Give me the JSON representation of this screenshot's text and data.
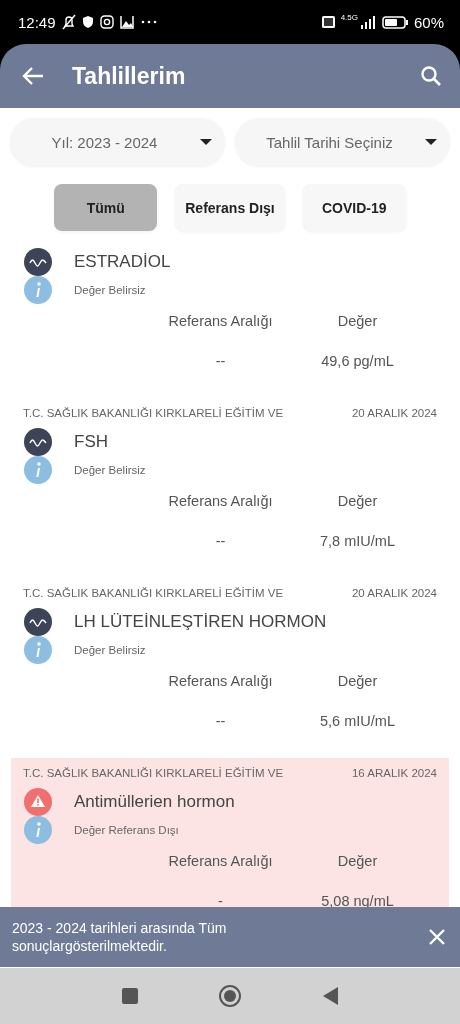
{
  "status_bar": {
    "time": "12:49",
    "network": "4.5G",
    "battery": "60%"
  },
  "app_bar": {
    "title": "Tahlillerim"
  },
  "filters": [
    {
      "label": "Yıl: 2023 - 2024"
    },
    {
      "label": "Tahlil Tarihi Seçiniz"
    }
  ],
  "chips": [
    {
      "label": "Tümü",
      "selected": true
    },
    {
      "label": "Referans Dışı",
      "selected": false
    },
    {
      "label": "COVID-19",
      "selected": false
    }
  ],
  "results": [
    {
      "test": "ESTRADİOL",
      "status": "Değer Belirsiz",
      "out_of_range": false,
      "range_label": "Referans Aralığı",
      "value_label": "Değer",
      "range": "--",
      "value": "49,6 pg/mL"
    },
    {
      "lab": "T.C. SAĞLIK BAKANLIĞI KIRKLARELİ EĞİTİM VE",
      "date": "20 ARALIK 2024",
      "test": "FSH",
      "status": "Değer Belirsiz",
      "out_of_range": false,
      "range_label": "Referans Aralığı",
      "value_label": "Değer",
      "range": "--",
      "value": "7,8 mIU/mL"
    },
    {
      "lab": "T.C. SAĞLIK BAKANLIĞI KIRKLARELİ EĞİTİM VE",
      "date": "20 ARALIK 2024",
      "test": "LH LÜTEİNLEŞTİREN HORMON",
      "status": "Değer Belirsiz",
      "out_of_range": false,
      "range_label": "Referans Aralığı",
      "value_label": "Değer",
      "range": "--",
      "value": "5,6 mIU/mL"
    },
    {
      "lab": "T.C. SAĞLIK BAKANLIĞI KIRKLARELİ EĞİTİM VE",
      "date": "16 ARALIK 2024",
      "test": "Antimüllerien hormon",
      "status": "Değer Referans Dışı",
      "out_of_range": true,
      "range_label": "Referans Aralığı",
      "value_label": "Değer",
      "range": "-",
      "value": "5,08 ng/mL"
    }
  ],
  "snackbar": {
    "message": "2023 - 2024 tarihleri arasında Tüm sonuçlargösterilmektedir."
  }
}
